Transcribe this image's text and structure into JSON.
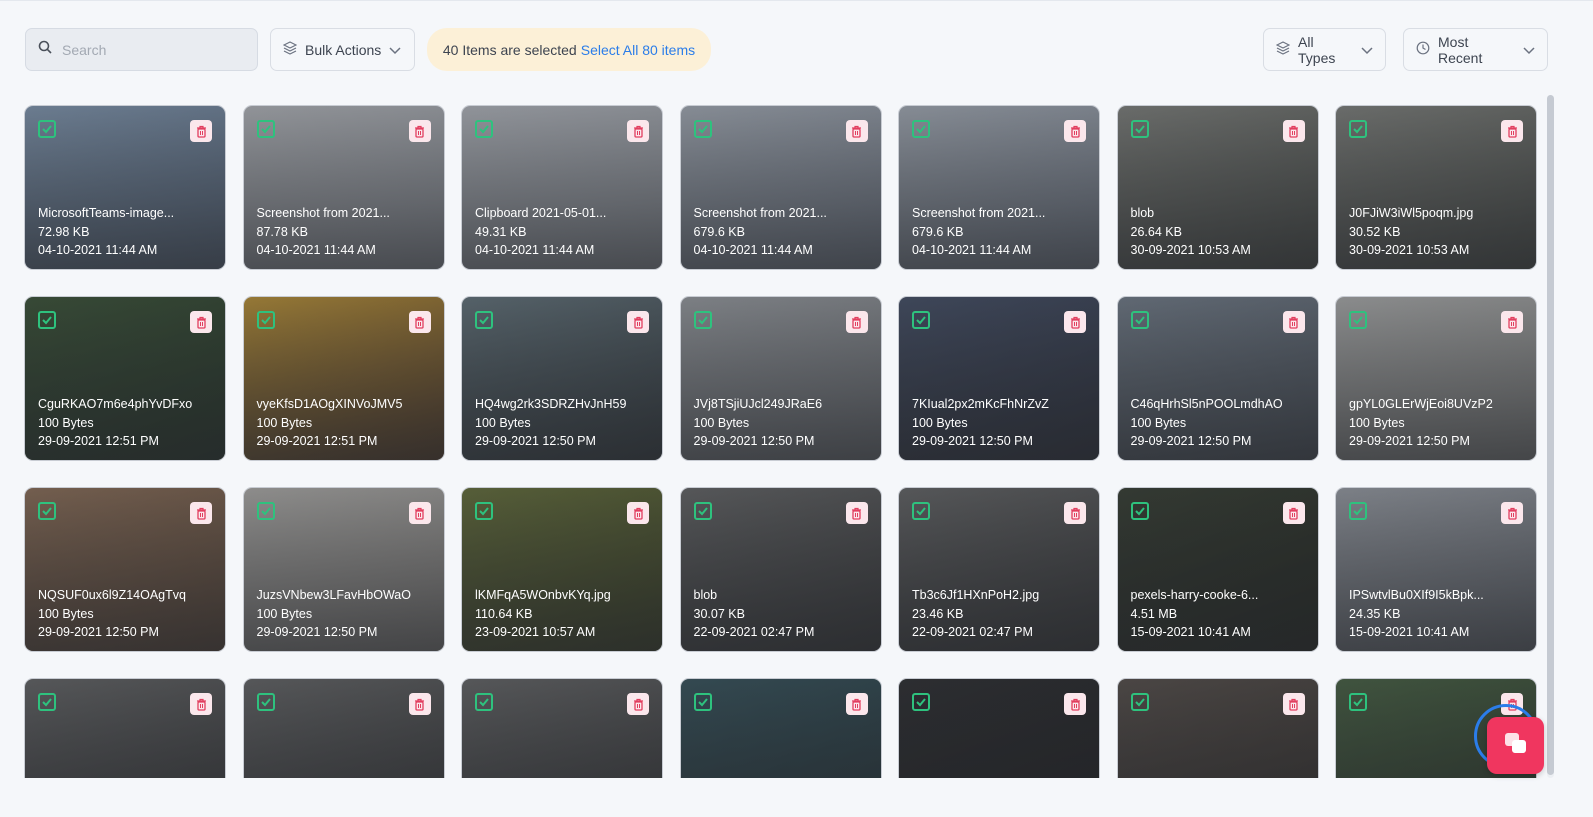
{
  "toolbar": {
    "search_placeholder": "Search",
    "bulk_label": "Bulk Actions",
    "selection_text": "40 Items are selected",
    "select_all_link": "Select All 80 items",
    "type_filter": "All Types",
    "sort_label": "Most Recent"
  },
  "colors": {
    "accent": "#2b7de9",
    "check": "#2ec27e",
    "delete": "#e23e5f",
    "fab": "#f0365f",
    "selection_bg": "#fcf0d7"
  },
  "items": [
    {
      "name": "MicrosoftTeams-image...",
      "size": "72.98 KB",
      "date": "04-10-2021 11:44 AM",
      "tone": [
        "#8fa8c4",
        "#5d6f86"
      ]
    },
    {
      "name": "Screenshot from 2021...",
      "size": "87.78 KB",
      "date": "04-10-2021 11:44 AM",
      "tone": [
        "#c9ccd1",
        "#9ca1a9"
      ]
    },
    {
      "name": "Clipboard 2021-05-01...",
      "size": "49.31 KB",
      "date": "04-10-2021 11:44 AM",
      "tone": [
        "#c8ccd3",
        "#9aa0a8"
      ]
    },
    {
      "name": "Screenshot from 2021...",
      "size": "679.6 KB",
      "date": "04-10-2021 11:44 AM",
      "tone": [
        "#b8c0cb",
        "#7d8796"
      ]
    },
    {
      "name": "Screenshot from 2021...",
      "size": "679.6 KB",
      "date": "04-10-2021 11:44 AM",
      "tone": [
        "#b8c0cb",
        "#7d8796"
      ]
    },
    {
      "name": "blob",
      "size": "26.64 KB",
      "date": "30-09-2021 10:53 AM",
      "tone": [
        "#8d8f8a",
        "#4e524c"
      ]
    },
    {
      "name": "J0FJiW3iWl5poqm.jpg",
      "size": "30.52 KB",
      "date": "30-09-2021 10:53 AM",
      "tone": [
        "#8d8f8a",
        "#4e524c"
      ]
    },
    {
      "name": "CguRKAO7m6e4phYvDFxo",
      "size": "100 Bytes",
      "date": "29-09-2021 12:51 PM",
      "tone": [
        "#3f5a3a",
        "#223325"
      ]
    },
    {
      "name": "vyeKfsD1AOgXINVoJMV5",
      "size": "100 Bytes",
      "date": "29-09-2021 12:51 PM",
      "tone": [
        "#d0a23a",
        "#5b3f28"
      ]
    },
    {
      "name": "HQ4wg2rk3SDRZHvJnH59",
      "size": "100 Bytes",
      "date": "29-09-2021 12:50 PM",
      "tone": [
        "#6d7f88",
        "#343d42"
      ]
    },
    {
      "name": "JVj8TSjiUJcl249JRaE6",
      "size": "100 Bytes",
      "date": "29-09-2021 12:50 PM",
      "tone": [
        "#a9adb2",
        "#777b80"
      ]
    },
    {
      "name": "7KIual2px2mKcFhNrZvZ",
      "size": "100 Bytes",
      "date": "29-09-2021 12:50 PM",
      "tone": [
        "#4a5670",
        "#2a2f3d"
      ]
    },
    {
      "name": "C46qHrhSl5nPOOLmdhAO",
      "size": "100 Bytes",
      "date": "29-09-2021 12:50 PM",
      "tone": [
        "#7e8a98",
        "#4e5660"
      ]
    },
    {
      "name": "gpYL0GLErWjEoi8UVzP2",
      "size": "100 Bytes",
      "date": "29-09-2021 12:50 PM",
      "tone": [
        "#bfc0bf",
        "#8e8f8d"
      ]
    },
    {
      "name": "NQSUF0ux6l9Z14OAgTvq",
      "size": "100 Bytes",
      "date": "29-09-2021 12:50 PM",
      "tone": [
        "#9b7a60",
        "#5d4838"
      ]
    },
    {
      "name": "JuzsVNbew3LFavHbOWaO",
      "size": "100 Bytes",
      "date": "29-09-2021 12:50 PM",
      "tone": [
        "#c3c1bd",
        "#8d8a86"
      ]
    },
    {
      "name": "lKMFqA5WOnbvKYq.jpg",
      "size": "110.64 KB",
      "date": "23-09-2021 10:57 AM",
      "tone": [
        "#6f7a3e",
        "#394022"
      ]
    },
    {
      "name": "blob",
      "size": "30.07 KB",
      "date": "22-09-2021 02:47 PM",
      "tone": [
        "#6e6f70",
        "#38393a"
      ]
    },
    {
      "name": "Tb3c6Jf1HXnPoH2.jpg",
      "size": "23.46 KB",
      "date": "22-09-2021 02:47 PM",
      "tone": [
        "#6e6f70",
        "#38393a"
      ]
    },
    {
      "name": "pexels-harry-cooke-6...",
      "size": "4.51 MB",
      "date": "15-09-2021 10:41 AM",
      "tone": [
        "#3a4235",
        "#1f231c"
      ]
    },
    {
      "name": "IPSwtvlBu0XIf9I5kBpk...",
      "size": "24.35 KB",
      "date": "15-09-2021 10:41 AM",
      "tone": [
        "#a9aeb6",
        "#6f747c"
      ]
    },
    {
      "name": "",
      "size": "",
      "date": "",
      "tone": [
        "#6e6f70",
        "#38393a"
      ]
    },
    {
      "name": "",
      "size": "",
      "date": "",
      "tone": [
        "#6e6f70",
        "#38393a"
      ]
    },
    {
      "name": "",
      "size": "",
      "date": "",
      "tone": [
        "#6e6f70",
        "#38393a"
      ]
    },
    {
      "name": "",
      "size": "",
      "date": "",
      "tone": [
        "#3a5a64",
        "#22343a"
      ]
    },
    {
      "name": "",
      "size": "",
      "date": "",
      "tone": [
        "#2f3033",
        "#1a1b1d"
      ]
    },
    {
      "name": "",
      "size": "",
      "date": "",
      "tone": [
        "#5d5550",
        "#35302c"
      ]
    },
    {
      "name": "",
      "size": "",
      "date": "",
      "tone": [
        "#4d6a48",
        "#2c3b28"
      ]
    }
  ]
}
